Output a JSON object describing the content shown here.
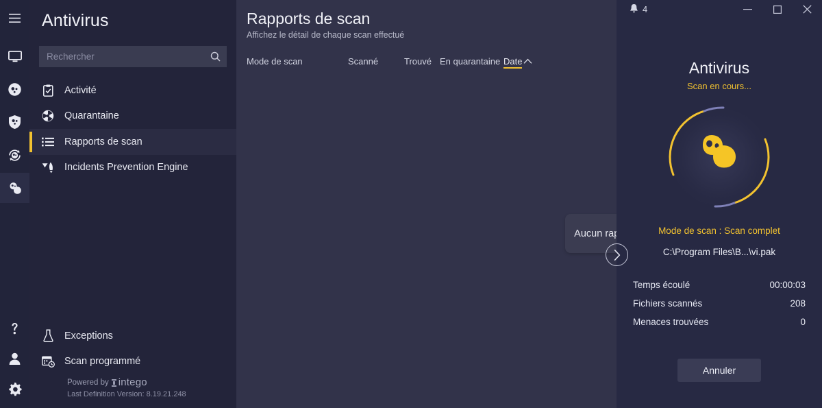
{
  "rail": {
    "items": [
      {
        "name": "menu-icon",
        "label": "Menu"
      },
      {
        "name": "monitor-icon",
        "label": "Tableau de bord"
      },
      {
        "name": "germ-circle-icon",
        "label": "Antivirus"
      },
      {
        "name": "shield-germ-icon",
        "label": "Protection"
      },
      {
        "name": "refresh-germ-icon",
        "label": "Mises à jour"
      },
      {
        "name": "virus-icon",
        "label": "Antivirus actif"
      },
      {
        "name": "help-icon",
        "label": "Aide"
      },
      {
        "name": "account-icon",
        "label": "Compte"
      },
      {
        "name": "settings-gear-icon",
        "label": "Paramètres"
      }
    ]
  },
  "sidebar": {
    "title": "Antivirus",
    "search": {
      "placeholder": "Rechercher",
      "value": ""
    },
    "items": [
      {
        "label": "Activité",
        "icon": "clipboard-check-icon",
        "active": false
      },
      {
        "label": "Quarantaine",
        "icon": "radiation-icon",
        "active": false
      },
      {
        "label": "Rapports de scan",
        "icon": "list-icon",
        "active": true
      },
      {
        "label": "Incidents Prevention Engine",
        "icon": "rocket-icon",
        "active": false
      }
    ],
    "bottom_items": [
      {
        "label": "Exceptions",
        "icon": "flask-icon"
      },
      {
        "label": "Scan programmé",
        "icon": "calendar-clock-icon"
      }
    ],
    "footer": {
      "powered_by": "Powered by",
      "brand": "intego",
      "definition": "Last Definition Version: 8.19.21.248"
    }
  },
  "main": {
    "title": "Rapports de scan",
    "subtitle": "Affichez le détail de chaque scan effectué",
    "columns": {
      "mode": "Mode de scan",
      "scanned": "Scanné",
      "found": "Trouvé",
      "quarantined": "En quarantaine",
      "date": "Date",
      "sort_caret": "⌃"
    },
    "empty_message": "Aucun rapport disponible. Lancer un scan."
  },
  "right": {
    "titlebar": {
      "notification_count": "4",
      "minimize": "—",
      "maximize": "▢",
      "close": "✕"
    },
    "title": "Antivirus",
    "state": "Scan en cours...",
    "mode_line": "Mode de scan : Scan complet",
    "current_path": "C:\\Program Files\\B...\\vi.pak",
    "stats": [
      {
        "label": "Temps écoulé",
        "value": "00:00:03"
      },
      {
        "label": "Fichiers scannés",
        "value": "208"
      },
      {
        "label": "Menaces trouvées",
        "value": "0"
      }
    ],
    "cancel_label": "Annuler",
    "expand_label": "›"
  },
  "colors": {
    "accent_yellow": "#f2c230",
    "rail_bg": "#22243a",
    "sidebar_bg": "#23243a",
    "main_bg": "#32334a",
    "right_bg": "#272943"
  }
}
